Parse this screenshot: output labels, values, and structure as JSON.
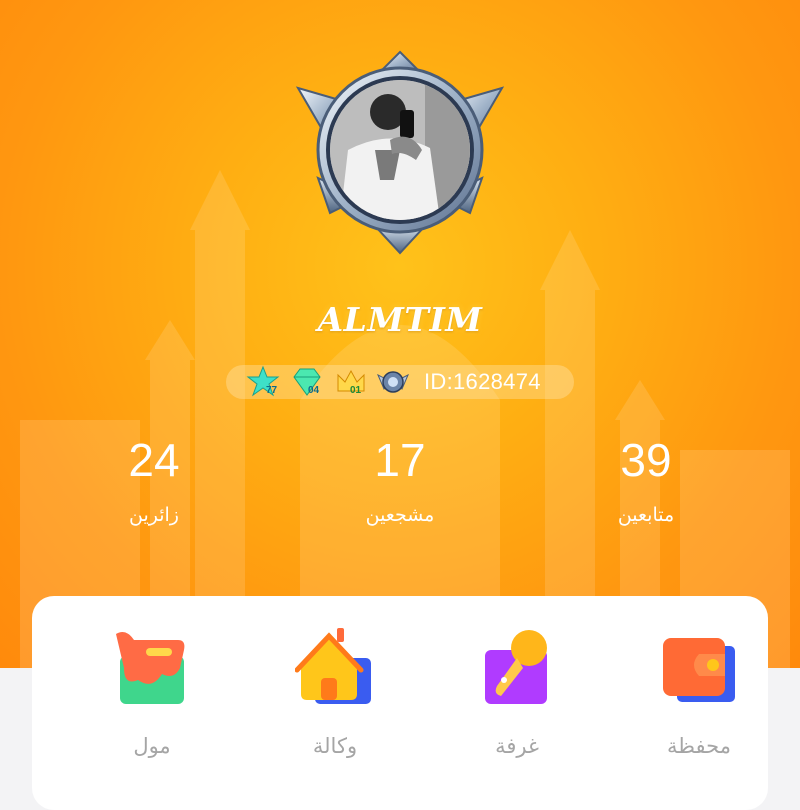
{
  "profile": {
    "name": "ALMTIM",
    "id_text": "ID:1628474",
    "levels": {
      "star": "77",
      "diamond": "04",
      "crown": "01"
    }
  },
  "stats": [
    {
      "value": "24",
      "label": "زائرين"
    },
    {
      "value": "17",
      "label": "مشجعين"
    },
    {
      "value": "39",
      "label": "متابعين"
    }
  ],
  "menu": [
    {
      "label": "مول",
      "icon": "mall-bag-icon"
    },
    {
      "label": "وكالة",
      "icon": "agency-house-icon"
    },
    {
      "label": "غرفة",
      "icon": "room-microphone-icon"
    },
    {
      "label": "محفظة",
      "icon": "wallet-icon"
    }
  ],
  "colors": {
    "hero_orange": "#ff9a10",
    "hero_yellow": "#ffc21a",
    "card_bg": "#ffffff",
    "label_gray": "#a5a5a5"
  }
}
